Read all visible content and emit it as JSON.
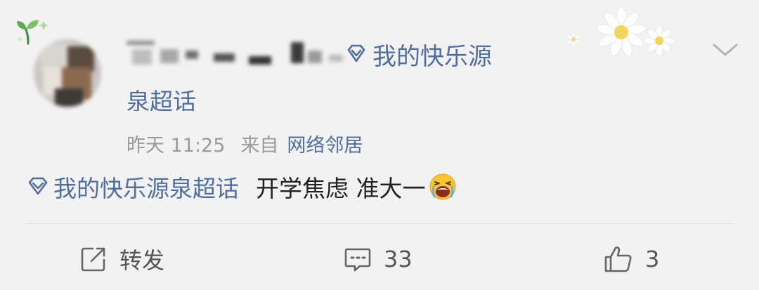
{
  "post": {
    "topic_link": "我的快乐源",
    "topic_link_cont": "泉超话",
    "time": "昨天 11:25",
    "source_prefix": "来自",
    "source_device": "网络邻居",
    "content": {
      "tag": "我的快乐源泉超话",
      "text": "开学焦虑 准大一",
      "emoji": "crying-face-emoji"
    }
  },
  "actions": {
    "repost_label": "转发",
    "comment_count": "33",
    "like_count": "3"
  },
  "colors": {
    "link": "#4f6fa3",
    "meta": "#9a9a9a",
    "text": "#222222",
    "background": "#f2f2f2"
  },
  "icons": [
    "sprout-icon",
    "diamond-topic-icon",
    "chevron-down-icon",
    "daisy-decoration",
    "repost-icon",
    "comment-icon",
    "thumbs-up-icon"
  ]
}
